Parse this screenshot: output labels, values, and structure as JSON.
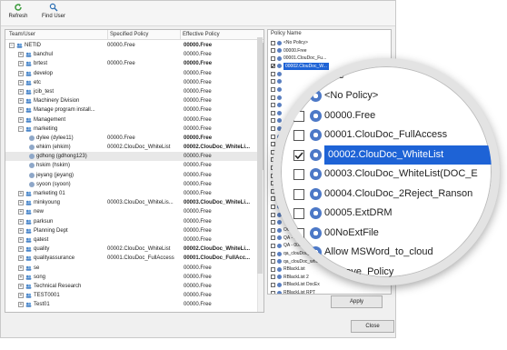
{
  "toolbar": {
    "refresh_label": "Refresh",
    "find_user_label": "Find User"
  },
  "tree": {
    "headers": {
      "team": "Team/User",
      "specified": "Specified Policy",
      "effective": "Effective Policy"
    },
    "rows": [
      {
        "name": "NETID",
        "spec": "00000.Free",
        "eff": "00000.Free",
        "bold": true,
        "kind": "root",
        "indent": 0
      },
      {
        "name": "banchul",
        "spec": "",
        "eff": "00000.Free",
        "bold": false,
        "kind": "team",
        "indent": 1
      },
      {
        "name": "brtest",
        "spec": "00000.Free",
        "eff": "00000.Free",
        "bold": true,
        "kind": "team",
        "indent": 1
      },
      {
        "name": "develop",
        "spec": "",
        "eff": "00000.Free",
        "bold": false,
        "kind": "team",
        "indent": 1
      },
      {
        "name": "etc",
        "spec": "",
        "eff": "00000.Free",
        "bold": false,
        "kind": "team",
        "indent": 1
      },
      {
        "name": "jcib_test",
        "spec": "",
        "eff": "00000.Free",
        "bold": false,
        "kind": "team",
        "indent": 1
      },
      {
        "name": "Machinery Division",
        "spec": "",
        "eff": "00000.Free",
        "bold": false,
        "kind": "team",
        "indent": 1
      },
      {
        "name": "Manage program install...",
        "spec": "",
        "eff": "00000.Free",
        "bold": false,
        "kind": "team",
        "indent": 1
      },
      {
        "name": "Management",
        "spec": "",
        "eff": "00000.Free",
        "bold": false,
        "kind": "team",
        "indent": 1
      },
      {
        "name": "marketing",
        "spec": "",
        "eff": "00000.Free",
        "bold": false,
        "kind": "team-open",
        "indent": 1
      },
      {
        "name": "dylee (dylee11)",
        "spec": "00000.Free",
        "eff": "00000.Free",
        "bold": true,
        "kind": "user",
        "indent": 2
      },
      {
        "name": "ehkim (ehkim)",
        "spec": "00002.ClouDoc_WhiteList",
        "eff": "00002.ClouDoc_WhiteLi...",
        "bold": true,
        "kind": "user",
        "indent": 2
      },
      {
        "name": "gdhong (gdhong123)",
        "spec": "",
        "eff": "00000.Free",
        "bold": false,
        "kind": "user",
        "indent": 2,
        "hl": true
      },
      {
        "name": "hskim (hskim)",
        "spec": "",
        "eff": "00000.Free",
        "bold": false,
        "kind": "user",
        "indent": 2
      },
      {
        "name": "jeyang (jeyang)",
        "spec": "",
        "eff": "00000.Free",
        "bold": false,
        "kind": "user",
        "indent": 2
      },
      {
        "name": "syoon (syoon)",
        "spec": "",
        "eff": "00000.Free",
        "bold": false,
        "kind": "user",
        "indent": 2
      },
      {
        "name": "marketing 01",
        "spec": "",
        "eff": "00000.Free",
        "bold": false,
        "kind": "team",
        "indent": 1
      },
      {
        "name": "minkyoung",
        "spec": "00003.ClouDoc_WhiteLis...",
        "eff": "00003.ClouDoc_WhiteLi...",
        "bold": true,
        "kind": "team",
        "indent": 1
      },
      {
        "name": "new",
        "spec": "",
        "eff": "00000.Free",
        "bold": false,
        "kind": "team",
        "indent": 1
      },
      {
        "name": "parksun",
        "spec": "",
        "eff": "00000.Free",
        "bold": false,
        "kind": "team",
        "indent": 1
      },
      {
        "name": "Planning Dept",
        "spec": "",
        "eff": "00000.Free",
        "bold": false,
        "kind": "team",
        "indent": 1
      },
      {
        "name": "qatest",
        "spec": "",
        "eff": "00000.Free",
        "bold": false,
        "kind": "team",
        "indent": 1
      },
      {
        "name": "quality",
        "spec": "00002.ClouDoc_WhiteList",
        "eff": "00002.ClouDoc_WhiteLi...",
        "bold": true,
        "kind": "team",
        "indent": 1
      },
      {
        "name": "qualityassurance",
        "spec": "00001.ClouDoc_FullAccess",
        "eff": "00001.ClouDoc_FullAcc...",
        "bold": true,
        "kind": "team",
        "indent": 1
      },
      {
        "name": "se",
        "spec": "",
        "eff": "00000.Free",
        "bold": false,
        "kind": "team",
        "indent": 1
      },
      {
        "name": "song",
        "spec": "",
        "eff": "00000.Free",
        "bold": false,
        "kind": "team",
        "indent": 1
      },
      {
        "name": "Technical Research",
        "spec": "",
        "eff": "00000.Free",
        "bold": false,
        "kind": "team",
        "indent": 1
      },
      {
        "name": "TEST0001",
        "spec": "",
        "eff": "00000.Free",
        "bold": false,
        "kind": "team",
        "indent": 1
      },
      {
        "name": "Test01",
        "spec": "",
        "eff": "00000.Free",
        "bold": false,
        "kind": "team",
        "indent": 1
      }
    ]
  },
  "policy": {
    "header": "Policy Name",
    "items": [
      {
        "label": "<No Policy>",
        "checked": false
      },
      {
        "label": "00000.Free",
        "checked": false
      },
      {
        "label": "00001.ClouDoc_Fu...",
        "checked": false
      },
      {
        "label": "00002.ClouDoc_W...",
        "checked": true,
        "selected": true
      },
      {
        "label": "",
        "checked": false
      },
      {
        "label": "",
        "checked": false
      },
      {
        "label": "",
        "checked": false
      },
      {
        "label": "",
        "checked": false
      },
      {
        "label": "",
        "checked": false
      },
      {
        "label": "",
        "checked": false
      },
      {
        "label": "",
        "checked": false
      },
      {
        "label": "",
        "checked": false
      },
      {
        "label": "",
        "checked": false
      },
      {
        "label": "",
        "checked": false
      },
      {
        "label": "",
        "checked": false
      },
      {
        "label": "",
        "checked": false
      },
      {
        "label": "",
        "checked": false
      },
      {
        "label": "",
        "checked": false
      },
      {
        "label": "",
        "checked": false
      },
      {
        "label": "",
        "checked": false
      },
      {
        "label": "",
        "checked": false
      },
      {
        "label": "",
        "checked": false
      },
      {
        "label": "",
        "checked": false
      },
      {
        "label": "",
        "checked": false
      },
      {
        "label": "OO...",
        "checked": false
      },
      {
        "label": "QA - 0000...",
        "checked": false
      },
      {
        "label": "QA - 0000...",
        "checked": false
      },
      {
        "label": "qa_clouDoc_2reje...",
        "checked": false
      },
      {
        "label": "qa_clouDoc_whitelist",
        "checked": false
      },
      {
        "label": "RBlackList",
        "checked": false
      },
      {
        "label": "RBlackList 2",
        "checked": false
      },
      {
        "label": "RBlackList DocEx",
        "checked": false
      },
      {
        "label": "RBlackList RPT",
        "checked": false
      }
    ],
    "apply_label": "Apply"
  },
  "close_label": "Close",
  "magnifier": {
    "title": "Policy Name",
    "items": [
      {
        "label": "<No Policy>",
        "checked": false
      },
      {
        "label": "00000.Free",
        "checked": false
      },
      {
        "label": "00001.ClouDoc_FullAccess",
        "checked": false
      },
      {
        "label": "00002.ClouDoc_WhiteList",
        "checked": true,
        "selected": true
      },
      {
        "label": "00003.ClouDoc_WhiteList(DOC_E",
        "checked": false
      },
      {
        "label": "00004.ClouDoc_2Reject_Ranson",
        "checked": false
      },
      {
        "label": "00005.ExtDRM",
        "checked": false
      },
      {
        "label": "00NoExtFile",
        "checked": false
      },
      {
        "label": "Allow MSWord_to_cloud",
        "checked": false
      },
      {
        "label": "Approve_Policy",
        "checked": false
      }
    ]
  },
  "colors": {
    "selection": "#1e63d6",
    "accent_icon": "#5a7fc0"
  }
}
